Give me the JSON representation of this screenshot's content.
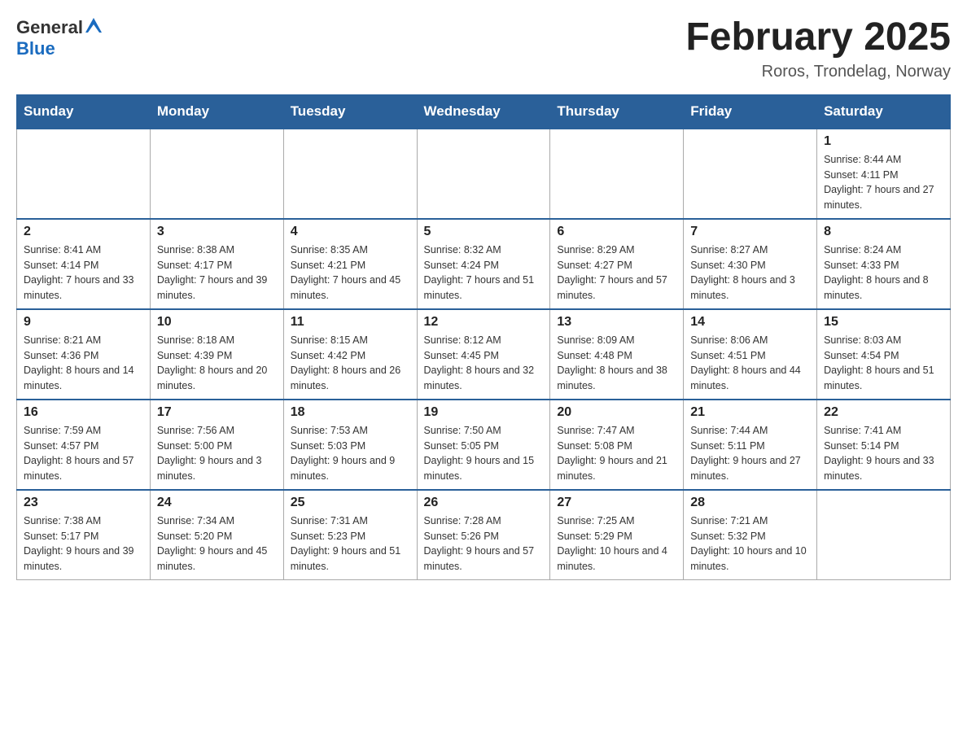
{
  "header": {
    "logo": {
      "general": "General",
      "blue": "Blue"
    },
    "title": "February 2025",
    "location": "Roros, Trondelag, Norway"
  },
  "days_of_week": [
    "Sunday",
    "Monday",
    "Tuesday",
    "Wednesday",
    "Thursday",
    "Friday",
    "Saturday"
  ],
  "weeks": [
    [
      {
        "day": "",
        "info": ""
      },
      {
        "day": "",
        "info": ""
      },
      {
        "day": "",
        "info": ""
      },
      {
        "day": "",
        "info": ""
      },
      {
        "day": "",
        "info": ""
      },
      {
        "day": "",
        "info": ""
      },
      {
        "day": "1",
        "info": "Sunrise: 8:44 AM\nSunset: 4:11 PM\nDaylight: 7 hours and 27 minutes."
      }
    ],
    [
      {
        "day": "2",
        "info": "Sunrise: 8:41 AM\nSunset: 4:14 PM\nDaylight: 7 hours and 33 minutes."
      },
      {
        "day": "3",
        "info": "Sunrise: 8:38 AM\nSunset: 4:17 PM\nDaylight: 7 hours and 39 minutes."
      },
      {
        "day": "4",
        "info": "Sunrise: 8:35 AM\nSunset: 4:21 PM\nDaylight: 7 hours and 45 minutes."
      },
      {
        "day": "5",
        "info": "Sunrise: 8:32 AM\nSunset: 4:24 PM\nDaylight: 7 hours and 51 minutes."
      },
      {
        "day": "6",
        "info": "Sunrise: 8:29 AM\nSunset: 4:27 PM\nDaylight: 7 hours and 57 minutes."
      },
      {
        "day": "7",
        "info": "Sunrise: 8:27 AM\nSunset: 4:30 PM\nDaylight: 8 hours and 3 minutes."
      },
      {
        "day": "8",
        "info": "Sunrise: 8:24 AM\nSunset: 4:33 PM\nDaylight: 8 hours and 8 minutes."
      }
    ],
    [
      {
        "day": "9",
        "info": "Sunrise: 8:21 AM\nSunset: 4:36 PM\nDaylight: 8 hours and 14 minutes."
      },
      {
        "day": "10",
        "info": "Sunrise: 8:18 AM\nSunset: 4:39 PM\nDaylight: 8 hours and 20 minutes."
      },
      {
        "day": "11",
        "info": "Sunrise: 8:15 AM\nSunset: 4:42 PM\nDaylight: 8 hours and 26 minutes."
      },
      {
        "day": "12",
        "info": "Sunrise: 8:12 AM\nSunset: 4:45 PM\nDaylight: 8 hours and 32 minutes."
      },
      {
        "day": "13",
        "info": "Sunrise: 8:09 AM\nSunset: 4:48 PM\nDaylight: 8 hours and 38 minutes."
      },
      {
        "day": "14",
        "info": "Sunrise: 8:06 AM\nSunset: 4:51 PM\nDaylight: 8 hours and 44 minutes."
      },
      {
        "day": "15",
        "info": "Sunrise: 8:03 AM\nSunset: 4:54 PM\nDaylight: 8 hours and 51 minutes."
      }
    ],
    [
      {
        "day": "16",
        "info": "Sunrise: 7:59 AM\nSunset: 4:57 PM\nDaylight: 8 hours and 57 minutes."
      },
      {
        "day": "17",
        "info": "Sunrise: 7:56 AM\nSunset: 5:00 PM\nDaylight: 9 hours and 3 minutes."
      },
      {
        "day": "18",
        "info": "Sunrise: 7:53 AM\nSunset: 5:03 PM\nDaylight: 9 hours and 9 minutes."
      },
      {
        "day": "19",
        "info": "Sunrise: 7:50 AM\nSunset: 5:05 PM\nDaylight: 9 hours and 15 minutes."
      },
      {
        "day": "20",
        "info": "Sunrise: 7:47 AM\nSunset: 5:08 PM\nDaylight: 9 hours and 21 minutes."
      },
      {
        "day": "21",
        "info": "Sunrise: 7:44 AM\nSunset: 5:11 PM\nDaylight: 9 hours and 27 minutes."
      },
      {
        "day": "22",
        "info": "Sunrise: 7:41 AM\nSunset: 5:14 PM\nDaylight: 9 hours and 33 minutes."
      }
    ],
    [
      {
        "day": "23",
        "info": "Sunrise: 7:38 AM\nSunset: 5:17 PM\nDaylight: 9 hours and 39 minutes."
      },
      {
        "day": "24",
        "info": "Sunrise: 7:34 AM\nSunset: 5:20 PM\nDaylight: 9 hours and 45 minutes."
      },
      {
        "day": "25",
        "info": "Sunrise: 7:31 AM\nSunset: 5:23 PM\nDaylight: 9 hours and 51 minutes."
      },
      {
        "day": "26",
        "info": "Sunrise: 7:28 AM\nSunset: 5:26 PM\nDaylight: 9 hours and 57 minutes."
      },
      {
        "day": "27",
        "info": "Sunrise: 7:25 AM\nSunset: 5:29 PM\nDaylight: 10 hours and 4 minutes."
      },
      {
        "day": "28",
        "info": "Sunrise: 7:21 AM\nSunset: 5:32 PM\nDaylight: 10 hours and 10 minutes."
      },
      {
        "day": "",
        "info": ""
      }
    ]
  ]
}
